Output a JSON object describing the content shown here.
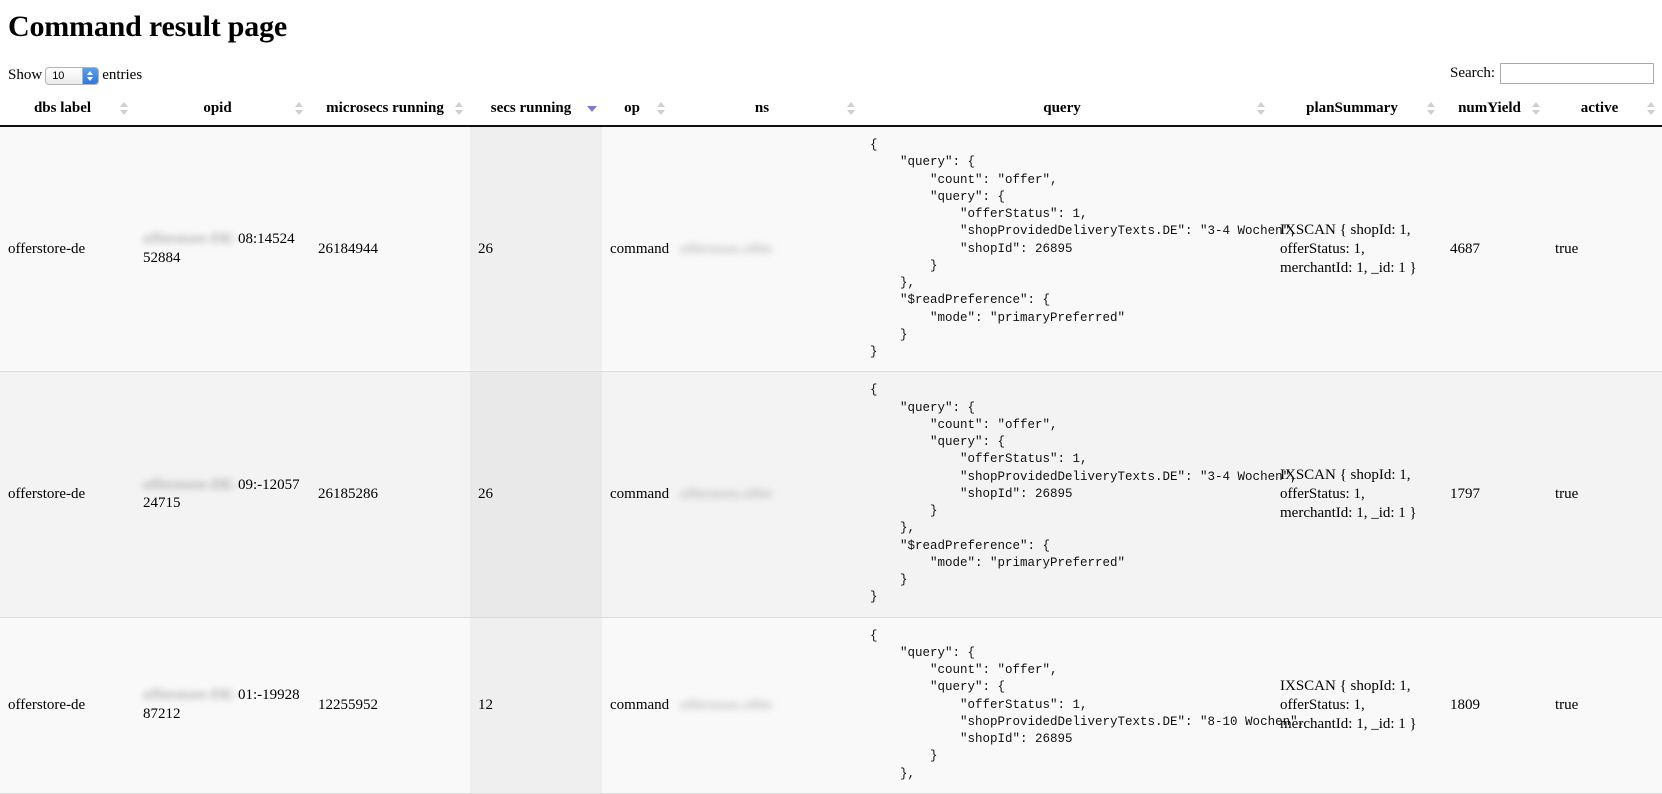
{
  "page": {
    "title": "Command result page"
  },
  "controls": {
    "length_prefix": "Show",
    "length_value": "10",
    "length_suffix": "entries",
    "search_label": "Search:",
    "search_value": "",
    "search_placeholder": ""
  },
  "table": {
    "columns": [
      {
        "key": "dbs_label",
        "label": "dbs label",
        "sort": "none"
      },
      {
        "key": "opid",
        "label": "opid",
        "sort": "none"
      },
      {
        "key": "microsecs_running",
        "label": "microsecs running",
        "sort": "none"
      },
      {
        "key": "secs_running",
        "label": "secs running",
        "sort": "desc"
      },
      {
        "key": "op",
        "label": "op",
        "sort": "none"
      },
      {
        "key": "ns",
        "label": "ns",
        "sort": "none"
      },
      {
        "key": "query",
        "label": "query",
        "sort": "none"
      },
      {
        "key": "plan_summary",
        "label": "planSummary",
        "sort": "none"
      },
      {
        "key": "num_yield",
        "label": "numYield",
        "sort": "none"
      },
      {
        "key": "active",
        "label": "active",
        "sort": "none"
      }
    ],
    "rows": [
      {
        "dbs_label": "offerstore-de",
        "opid_redacted": "offerstore-DE-",
        "opid": "08:1452452884",
        "microsecs_running": "26184944",
        "secs_running": "26",
        "op": "command",
        "ns_redacted": "offerstore.offer",
        "query": "{\n    \"query\": {\n        \"count\": \"offer\",\n        \"query\": {\n            \"offerStatus\": 1,\n            \"shopProvidedDeliveryTexts.DE\": \"3-4 Wochen\",\n            \"shopId\": 26895\n        }\n    },\n    \"$readPreference\": {\n        \"mode\": \"primaryPreferred\"\n    }\n}",
        "plan_summary": "IXSCAN { shopId: 1, offerStatus: 1, merchantId: 1, _id: 1 }",
        "num_yield": "4687",
        "active": "true"
      },
      {
        "dbs_label": "offerstore-de",
        "opid_redacted": "offerstore-DE-",
        "opid": "09:-1205724715",
        "microsecs_running": "26185286",
        "secs_running": "26",
        "op": "command",
        "ns_redacted": "offerstore.offer",
        "query": "{\n    \"query\": {\n        \"count\": \"offer\",\n        \"query\": {\n            \"offerStatus\": 1,\n            \"shopProvidedDeliveryTexts.DE\": \"3-4 Wochen\",\n            \"shopId\": 26895\n        }\n    },\n    \"$readPreference\": {\n        \"mode\": \"primaryPreferred\"\n    }\n}",
        "plan_summary": "IXSCAN { shopId: 1, offerStatus: 1, merchantId: 1, _id: 1 }",
        "num_yield": "1797",
        "active": "true"
      },
      {
        "dbs_label": "offerstore-de",
        "opid_redacted": "offerstore-DE-",
        "opid": "01:-1992887212",
        "microsecs_running": "12255952",
        "secs_running": "12",
        "op": "command",
        "ns_redacted": "offerstore.offer",
        "query": "{\n    \"query\": {\n        \"count\": \"offer\",\n        \"query\": {\n            \"offerStatus\": 1,\n            \"shopProvidedDeliveryTexts.DE\": \"8-10 Wochen\",\n            \"shopId\": 26895\n        }\n    },",
        "plan_summary": "IXSCAN { shopId: 1, offerStatus: 1, merchantId: 1, _id: 1 }",
        "num_yield": "1809",
        "active": "true"
      }
    ]
  }
}
